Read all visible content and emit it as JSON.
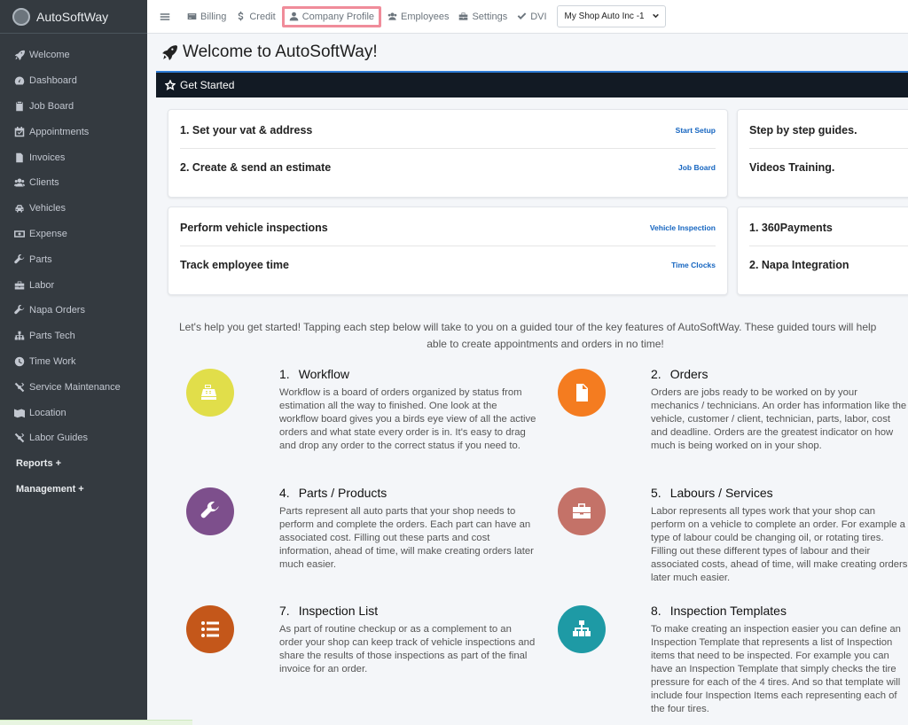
{
  "brand": {
    "name": "AutoSoftWay"
  },
  "sidebar": {
    "items": [
      {
        "label": "Welcome",
        "icon": "rocket-icon"
      },
      {
        "label": "Dashboard",
        "icon": "tachometer-icon"
      },
      {
        "label": "Job Board",
        "icon": "clipboard-icon"
      },
      {
        "label": "Appointments",
        "icon": "calendar-check-icon"
      },
      {
        "label": "Invoices",
        "icon": "invoice-icon"
      },
      {
        "label": "Clients",
        "icon": "users-icon"
      },
      {
        "label": "Vehicles",
        "icon": "car-icon"
      },
      {
        "label": "Expense",
        "icon": "money-icon"
      },
      {
        "label": "Parts",
        "icon": "wrench-icon"
      },
      {
        "label": "Labor",
        "icon": "toolbox-icon"
      },
      {
        "label": "Napa Orders",
        "icon": "wrench-icon"
      },
      {
        "label": "Parts Tech",
        "icon": "sitemap-icon"
      },
      {
        "label": "Time Work",
        "icon": "clock-icon"
      },
      {
        "label": "Service Maintenance",
        "icon": "tools-icon"
      },
      {
        "label": "Location",
        "icon": "map-icon"
      },
      {
        "label": "Labor Guides",
        "icon": "tools-icon"
      }
    ],
    "groups": [
      {
        "label": "Reports +"
      },
      {
        "label": "Management +"
      }
    ]
  },
  "topbar": {
    "billing": "Billing",
    "credit": "Credit",
    "company_profile": "Company Profile",
    "employees": "Employees",
    "settings": "Settings",
    "dvi": "DVI",
    "shop_select": "My Shop Auto Inc -1"
  },
  "page": {
    "title": "Welcome to AutoSoftWay!",
    "get_started": "Get Started"
  },
  "cards": {
    "setup": [
      {
        "label": "1. Set your vat & address",
        "link": "Start Setup"
      },
      {
        "label": "2. Create & send an estimate",
        "link": "Job Board"
      }
    ],
    "guides": [
      {
        "label": "Step by step guides."
      },
      {
        "label": "Videos Training."
      }
    ],
    "inspections": [
      {
        "label": "Perform vehicle inspections",
        "link": "Vehicle Inspection"
      },
      {
        "label": "Track employee time",
        "link": "Time Clocks"
      }
    ],
    "integrations": [
      {
        "label": "1. 360Payments"
      },
      {
        "label": "2. Napa Integration"
      }
    ]
  },
  "intro": {
    "line1": "Let's help you get started! Tapping each step below will take to you on a guided tour of the key features of AutoSoftWay. These guided tours will help",
    "line2": "able to create appointments and orders in no time!"
  },
  "features": [
    {
      "num": "1.",
      "title": "Workflow",
      "color": "#e1de4a",
      "icon": "cash-register-icon",
      "desc": "Workflow is a board of orders organized by status from estimation all the way to finished. One look at the workflow board gives you a birds eye view of all the active orders and what state every order is in. It's easy to drag and drop any order to the correct status if you need to."
    },
    {
      "num": "2.",
      "title": "Orders",
      "color": "#f47c20",
      "icon": "document-icon",
      "desc": "Orders are jobs ready to be worked on by your mechanics / technicians. An order has information like the vehicle, customer / client, technician, parts, labor, cost and deadline. Orders are the greatest indicator on how much is being worked on in your shop."
    },
    {
      "num": "4.",
      "title": "Parts / Products",
      "color": "#7d4f8c",
      "icon": "wrench-icon",
      "desc": "Parts represent all auto parts that your shop needs to perform and complete the orders. Each part can have an associated cost. Filling out these parts and cost information, ahead of time, will make creating orders later much easier."
    },
    {
      "num": "5.",
      "title": "Labours / Services",
      "color": "#c47268",
      "icon": "toolbox-icon",
      "desc": "Labor represents all types work that your shop can perform on a vehicle to complete an order. For example a type of labour could be changing oil, or rotating tires. Filling out these different types of labour and their associated costs, ahead of time, will make creating orders later much easier."
    },
    {
      "num": "7.",
      "title": "Inspection List",
      "color": "#c4571a",
      "icon": "list-icon",
      "desc": "As part of routine checkup or as a complement to an order your shop can keep track of vehicle inspections and share the results of those inspections as part of the final invoice for an order."
    },
    {
      "num": "8.",
      "title": "Inspection Templates",
      "color": "#1e9aa5",
      "icon": "sitemap-icon",
      "desc": "To make creating an inspection easier you can define an Inspection Template that represents a list of Inspection items that need to be inspected. For example you can have an Inspection Template that simply checks the tire pressure for each of the 4 tires. And so that template will include four Inspection Items each representing each of the four tires."
    }
  ]
}
